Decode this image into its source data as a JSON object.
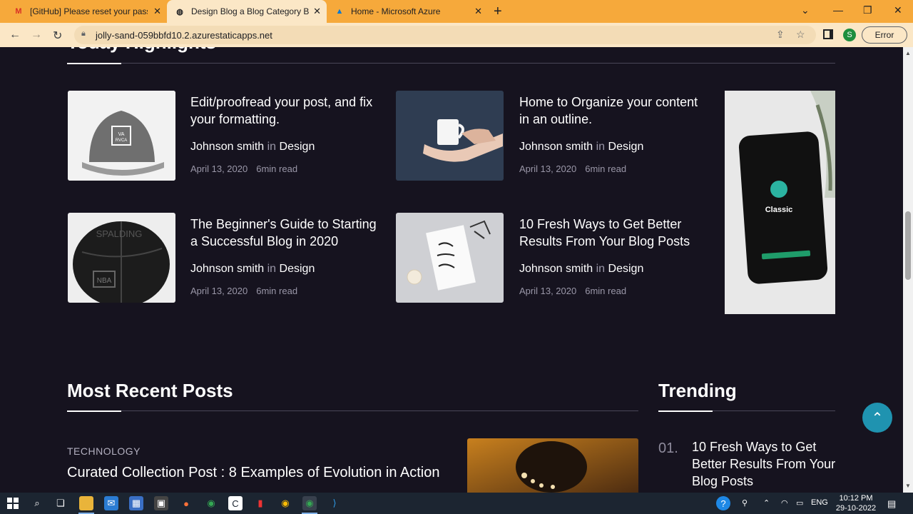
{
  "browser": {
    "tabs": [
      {
        "title": "[GitHub] Please reset your passw",
        "favicon": "gmail-icon"
      },
      {
        "title": "Design Blog a Blog Category Bo",
        "favicon": "globe-icon"
      },
      {
        "title": "Home - Microsoft Azure",
        "favicon": "azure-icon"
      }
    ],
    "url": "jolly-sand-059bbfd10.2.azurestaticapps.net",
    "profile_initial": "S",
    "error_label": "Error"
  },
  "highlights": {
    "section_title": "Today Highlights",
    "posts": [
      {
        "title": "Edit/proofread your post, and fix your formatting.",
        "author": "Johnson smith",
        "in": "in",
        "category": "Design",
        "date": "April 13, 2020",
        "read": "6min read"
      },
      {
        "title": "Home to Organize your content in an outline.",
        "author": "Johnson smith",
        "in": "in",
        "category": "Design",
        "date": "April 13, 2020",
        "read": "6min read"
      },
      {
        "title": "The Beginner's Guide to Starting a Successful Blog in 2020",
        "author": "Johnson smith",
        "in": "in",
        "category": "Design",
        "date": "April 13, 2020",
        "read": "6min read"
      },
      {
        "title": "10 Fresh Ways to Get Better Results From Your Blog Posts",
        "author": "Johnson smith",
        "in": "in",
        "category": "Design",
        "date": "April 13, 2020",
        "read": "6min read"
      }
    ],
    "phone_label": "Classic"
  },
  "recent": {
    "section_title": "Most Recent Posts",
    "category": "TECHNOLOGY",
    "title": "Curated Collection Post : 8 Examples of Evolution in Action"
  },
  "trending": {
    "section_title": "Trending",
    "items": [
      {
        "num": "01.",
        "title": "10 Fresh Ways to Get Better Results From Your Blog Posts"
      }
    ]
  },
  "taskbar": {
    "lang": "ENG",
    "time": "10:12 PM",
    "date": "29-10-2022"
  },
  "colors": {
    "page_bg": "#16131f",
    "tabbar": "#f6a93b",
    "accent": "#1f93b0"
  }
}
